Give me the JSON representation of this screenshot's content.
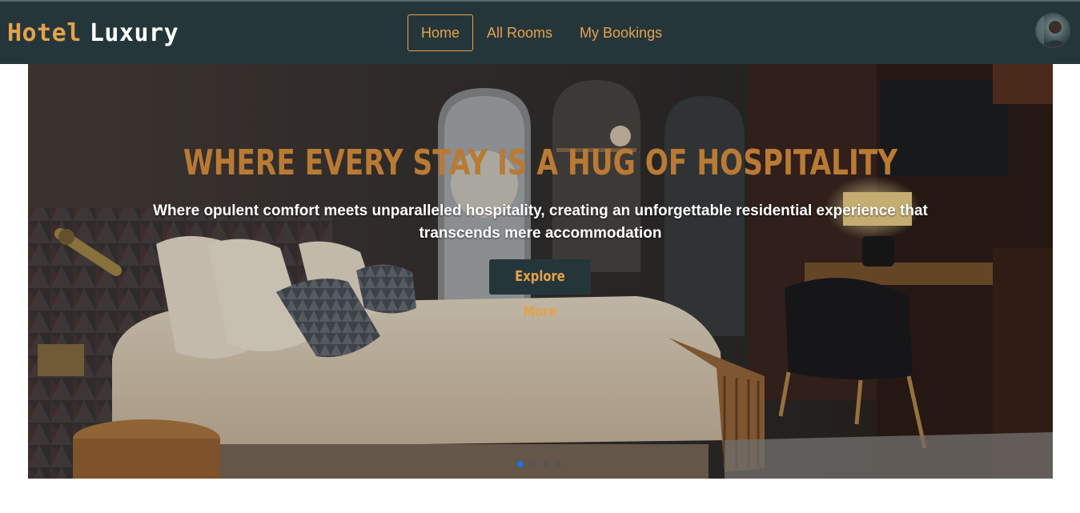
{
  "brand": {
    "part1": "Hotel",
    "part2": "Luxury"
  },
  "nav": {
    "items": [
      {
        "label": "Home",
        "active": true
      },
      {
        "label": "All Rooms",
        "active": false
      },
      {
        "label": "My Bookings",
        "active": false
      }
    ]
  },
  "user": {
    "avatar_icon": "user-avatar-icon"
  },
  "hero": {
    "headline": "WHERE EVERY STAY IS A HUG OF HOSPITALITY",
    "subline": "Where opulent comfort meets unparalleled hospitality, creating an unforgettable residential experience that transcends mere accommodation",
    "cta_label": "Explore More",
    "slide_count": 4,
    "active_slide": 1
  },
  "colors": {
    "navbar_bg": "#25363b",
    "accent": "#e4a24a",
    "headline": "#b97a35",
    "active_dot": "#1e6fe0"
  }
}
